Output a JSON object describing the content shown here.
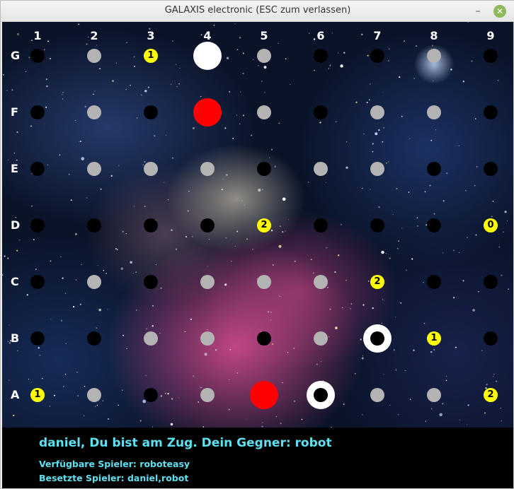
{
  "window": {
    "title": "GALAXIS electronic   (ESC zum verlassen)",
    "minimize_glyph": "–",
    "close_glyph": "✕",
    "accent": "#8fb85a"
  },
  "board": {
    "columns": [
      "1",
      "2",
      "3",
      "4",
      "5",
      "6",
      "7",
      "8",
      "9"
    ],
    "rows": [
      "G",
      "F",
      "E",
      "D",
      "C",
      "B",
      "A"
    ],
    "legend_colors": {
      "unprobed": "#000000",
      "empty": "#b3b3b3",
      "count": "#ffff00",
      "ship_found": "#ffffff",
      "ship_hit": "#ff0000"
    },
    "cells": [
      [
        "black",
        "gray",
        "1",
        "white",
        "gray",
        "black",
        "black",
        "gray",
        "black"
      ],
      [
        "black",
        "gray",
        "black",
        "red",
        "gray",
        "black",
        "gray",
        "gray",
        "black"
      ],
      [
        "black",
        "gray",
        "gray",
        "gray",
        "black",
        "gray",
        "gray",
        "black",
        "black"
      ],
      [
        "black",
        "black",
        "black",
        "black",
        "2",
        "black",
        "black",
        "black",
        "0"
      ],
      [
        "black",
        "gray",
        "black",
        "gray",
        "gray",
        "gray",
        "2",
        "black",
        "black"
      ],
      [
        "black",
        "black",
        "gray",
        "gray",
        "black",
        "gray",
        "ring",
        "1",
        "black"
      ],
      [
        "1",
        "gray",
        "black",
        "gray",
        "red",
        "ring",
        "gray",
        "gray",
        "2"
      ]
    ]
  },
  "status": {
    "turn_text": "daniel, Du bist am Zug. Dein Gegner: robot",
    "available_text": "Verfügbare Spieler: roboteasy",
    "taken_text": "Besetzte Spieler: daniel,robot",
    "text_color": "#5ee0f0"
  }
}
